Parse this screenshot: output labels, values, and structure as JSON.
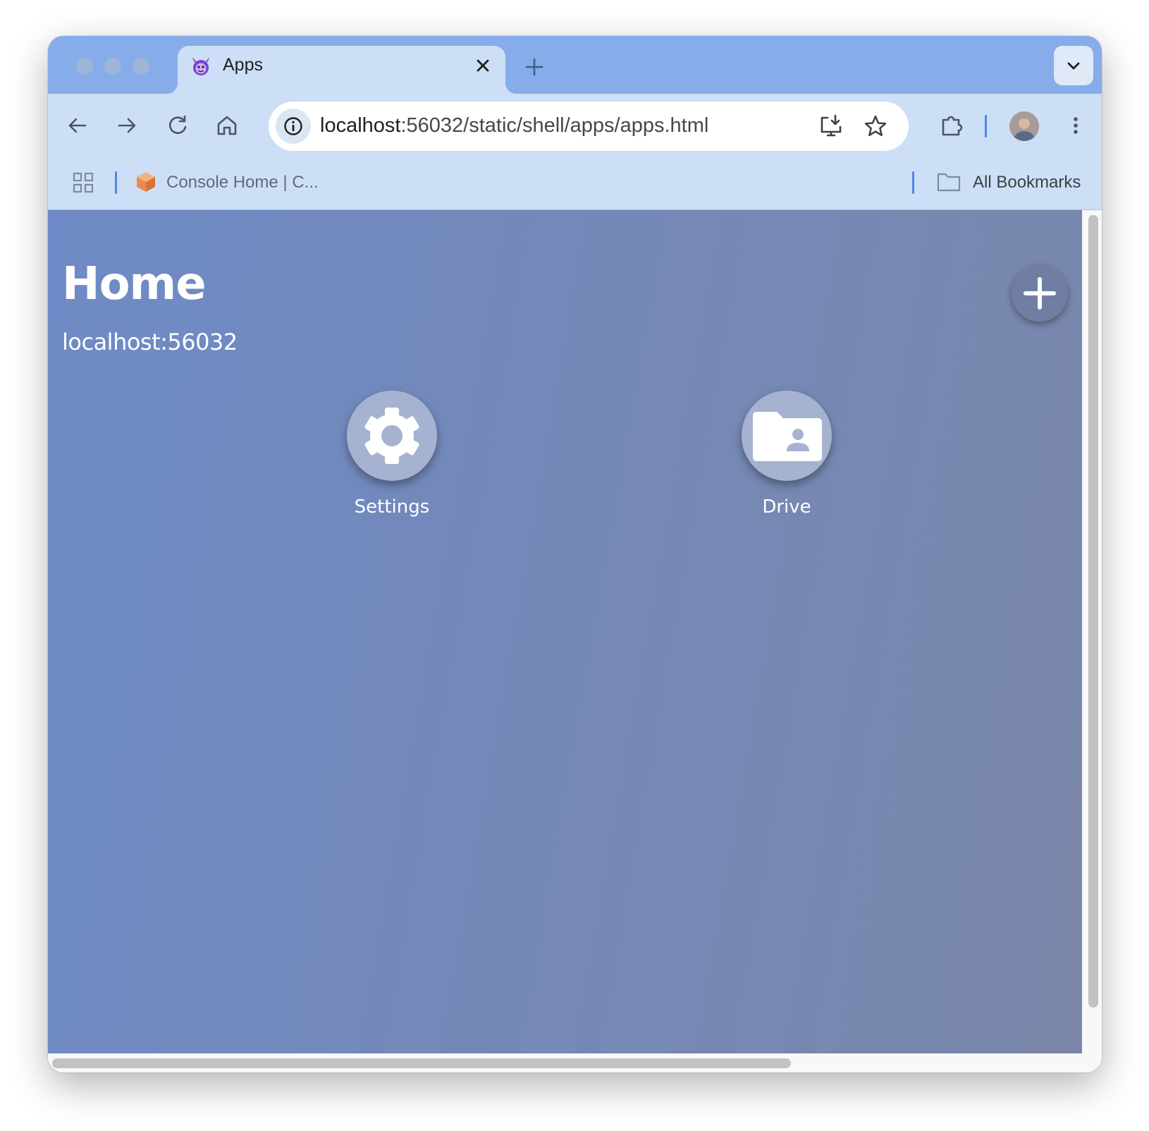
{
  "browser": {
    "tab": {
      "title": "Apps",
      "favicon": "devil-mascot-icon"
    },
    "address_bar": {
      "host": "localhost",
      "rest": ":56032/static/shell/apps/apps.html"
    },
    "bookmarks": [
      {
        "label": "Console Home | C...",
        "icon": "cube-icon"
      }
    ],
    "all_bookmarks_label": "All Bookmarks"
  },
  "page": {
    "title": "Home",
    "subtitle": "localhost:56032",
    "apps": [
      {
        "label": "Settings",
        "icon": "gear-icon"
      },
      {
        "label": "Drive",
        "icon": "shared-folder-icon"
      }
    ],
    "add_button_icon": "plus-icon"
  },
  "colors": {
    "tabstrip": "#86acea",
    "toolbar": "#cddff6",
    "page_gradient_start": "#6f8ac6",
    "page_gradient_end": "#7a87aa",
    "app_icon_bg": "#a5b3d0"
  }
}
